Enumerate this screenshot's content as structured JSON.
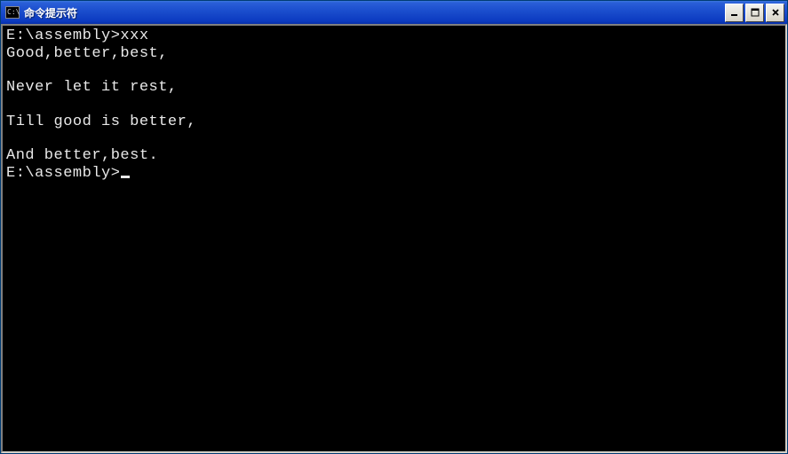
{
  "window": {
    "title": "命令提示符",
    "icon_text": "C:\\"
  },
  "terminal": {
    "lines": [
      {
        "prompt": "E:\\assembly>",
        "cmd": "xxx"
      },
      {
        "text": "Good,better,best,"
      },
      {
        "text": ""
      },
      {
        "text": "Never let it rest,"
      },
      {
        "text": ""
      },
      {
        "text": "Till good is better,"
      },
      {
        "text": ""
      },
      {
        "text": "And better,best."
      }
    ],
    "current_prompt": "E:\\assembly>"
  }
}
